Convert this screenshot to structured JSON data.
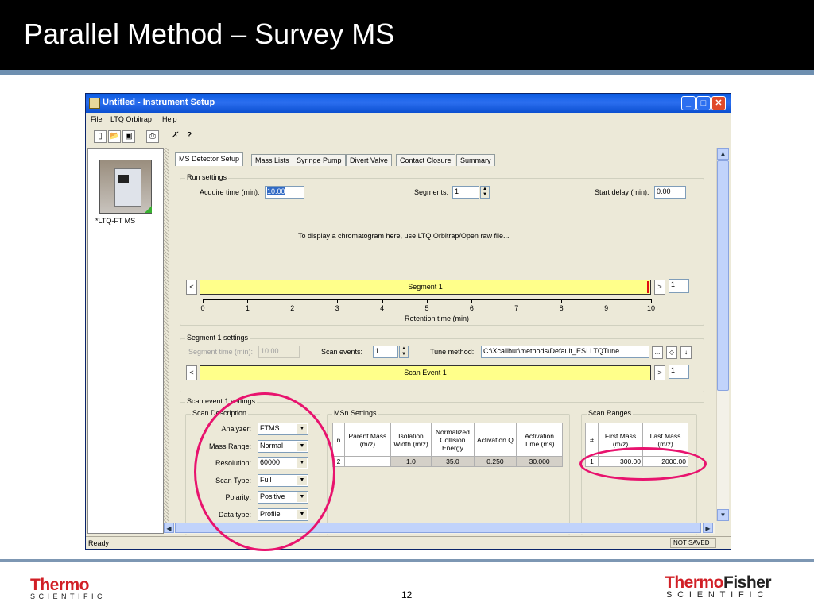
{
  "slide": {
    "title": "Parallel Method – Survey MS",
    "page_number": "12",
    "logo_left": "Thermo",
    "logo_left_sub": "SCIENTIFIC",
    "logo_right_a": "Thermo",
    "logo_right_b": "Fisher",
    "logo_right_sub": "SCIENTIFIC"
  },
  "window": {
    "title": "Untitled - Instrument Setup",
    "menu": [
      "File",
      "LTQ Orbitrap",
      "Help"
    ],
    "instrument_label": "*LTQ-FT MS",
    "tabs": [
      "MS Detector Setup",
      "Mass Lists",
      "Syringe Pump",
      "Divert Valve",
      "Contact Closure",
      "Summary"
    ],
    "status_left": "Ready",
    "status_right": "NOT SAVED"
  },
  "run_settings": {
    "title": "Run settings",
    "acquire_label": "Acquire time (min):",
    "acquire_value": "10.00",
    "segments_label": "Segments:",
    "segments_value": "1",
    "start_delay_label": "Start delay (min):",
    "start_delay_value": "0.00",
    "chromatogram_hint": "To display a chromatogram here, use LTQ Orbitrap/Open raw file...",
    "segment_bar": "Segment 1",
    "segment_index": "1",
    "axis_ticks": [
      "0",
      "1",
      "2",
      "3",
      "4",
      "5",
      "6",
      "7",
      "8",
      "9",
      "10"
    ],
    "axis_label": "Retention time (min)"
  },
  "segment_settings": {
    "title": "Segment 1 settings",
    "segment_time_label": "Segment time (min):",
    "segment_time_value": "10.00",
    "scan_events_label": "Scan events:",
    "scan_events_value": "1",
    "tune_method_label": "Tune method:",
    "tune_method_value": "C:\\Xcalibur\\methods\\Default_ESI.LTQTune",
    "browse": "...",
    "event_bar": "Scan Event 1",
    "event_index": "1"
  },
  "scan_event": {
    "title": "Scan event 1 settings",
    "desc_title": "Scan Description",
    "fields": [
      {
        "label": "Analyzer:",
        "value": "FTMS"
      },
      {
        "label": "Mass Range:",
        "value": "Normal"
      },
      {
        "label": "Resolution:",
        "value": "60000"
      },
      {
        "label": "Scan Type:",
        "value": "Full"
      },
      {
        "label": "Polarity:",
        "value": "Positive"
      },
      {
        "label": "Data type:",
        "value": "Profile"
      }
    ],
    "msn_title": "MSn Settings",
    "msn_headers": [
      "n",
      "Parent Mass (m/z)",
      "Isolation Width (m/z)",
      "Normalized Collision Energy",
      "Activation Q",
      "Activation Time (ms)"
    ],
    "msn_row": [
      "2",
      "",
      "1.0",
      "35.0",
      "0.250",
      "30.000"
    ],
    "ranges_title": "Scan Ranges",
    "ranges_headers": [
      "#",
      "First Mass (m/z)",
      "Last Mass (m/z)"
    ],
    "ranges_row": [
      "1",
      "300.00",
      "2000.00"
    ]
  },
  "colors": {
    "highlight_ring": "#e8136e",
    "segment_fill": "#ffff8a",
    "brand_red": "#d11f26"
  }
}
